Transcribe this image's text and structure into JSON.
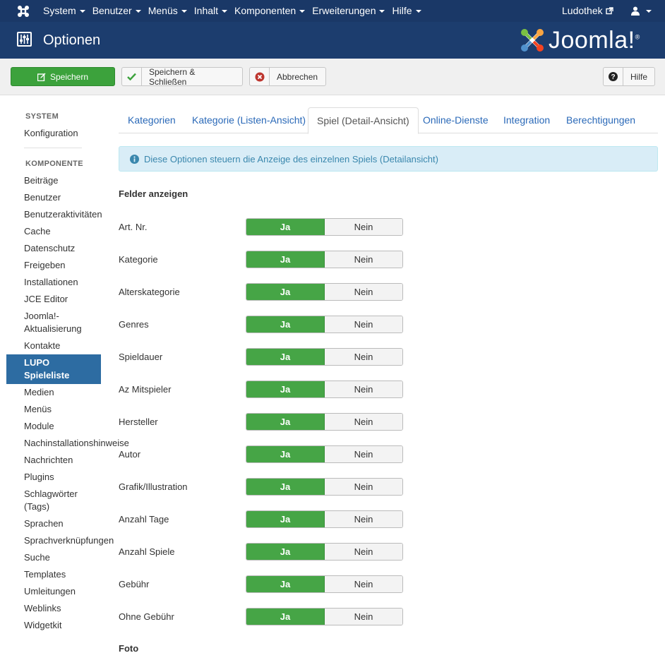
{
  "navbar": {
    "menu": [
      "System",
      "Benutzer",
      "Menüs",
      "Inhalt",
      "Komponenten",
      "Erweiterungen",
      "Hilfe"
    ],
    "site_name": "Ludothek"
  },
  "header": {
    "title": "Optionen",
    "brand": "Joomla!",
    "brand_reg": "®"
  },
  "toolbar": {
    "save_label": "Speichern",
    "save_close_label": "Speichern & Schließen",
    "cancel_label": "Abbrechen",
    "help_label": "Hilfe"
  },
  "sidebar": {
    "system_heading": "SYSTEM",
    "system_items": [
      "Konfiguration"
    ],
    "component_heading": "KOMPONENTE",
    "items": [
      "Beiträge",
      "Benutzer",
      "Benutzeraktivitäten",
      "Cache",
      "Datenschutz",
      "Freigeben",
      "Installationen",
      "JCE Editor",
      "Joomla!-",
      "Aktualisierung",
      "Kontakte",
      "LUPO",
      "Spieleliste",
      "Medien",
      "Menüs",
      "Module",
      "Nachinstallationshinweise",
      "Nachrichten",
      "Plugins",
      "Schlagwörter",
      "(Tags)",
      "Sprachen",
      "Sprachverknüpfungen",
      "Suche",
      "Templates",
      "Umleitungen",
      "Weblinks",
      "Widgetkit"
    ]
  },
  "tabs": [
    {
      "label": "Kategorien",
      "active": false
    },
    {
      "label": "Kategorie (Listen-Ansicht)",
      "active": false
    },
    {
      "label": "Spiel (Detail-Ansicht)",
      "active": true
    },
    {
      "label": "Online-Dienste",
      "active": false
    },
    {
      "label": "Integration",
      "active": false
    },
    {
      "label": "Berechtigungen",
      "active": false
    }
  ],
  "info_text": "Diese Optionen steuern die Anzeige des einzelnen Spiels (Detailansicht)",
  "section_fields": "Felder anzeigen",
  "section_foto": "Foto",
  "toggle_yes": "Ja",
  "toggle_no": "Nein",
  "fields": [
    {
      "label": "Art. Nr.",
      "value": "Ja"
    },
    {
      "label": "Kategorie",
      "value": "Ja"
    },
    {
      "label": "Alterskategorie",
      "value": "Ja"
    },
    {
      "label": "Genres",
      "value": "Ja"
    },
    {
      "label": "Spieldauer",
      "value": "Ja"
    },
    {
      "label": "Az Mitspieler",
      "value": "Ja"
    },
    {
      "label": "Hersteller",
      "value": "Ja"
    },
    {
      "label": "Autor",
      "value": "Ja"
    },
    {
      "label": "Grafik/Illustration",
      "value": "Ja"
    },
    {
      "label": "Anzahl Tage",
      "value": "Ja"
    },
    {
      "label": "Anzahl Spiele",
      "value": "Ja"
    },
    {
      "label": "Gebühr",
      "value": "Ja"
    },
    {
      "label": "Ohne Gebühr",
      "value": "Ja"
    }
  ],
  "colors": {
    "navbar": "#1a3867",
    "header": "#1c3d6e",
    "save_green": "#3ca23c",
    "active_sidebar": "#2d6ca2",
    "link_blue": "#2a69b8",
    "info_bg": "#d9edf7"
  }
}
